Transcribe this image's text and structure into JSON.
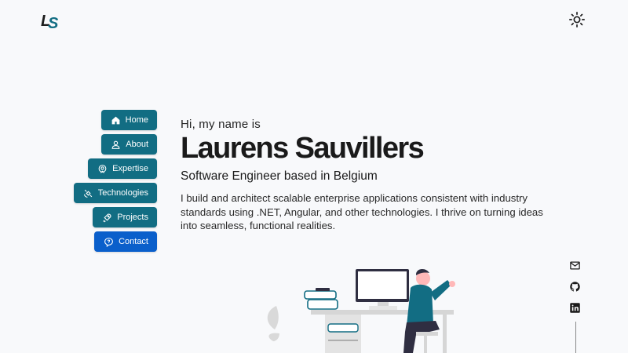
{
  "header": {
    "logo_text": "LS",
    "theme_toggle_icon": "sun-icon"
  },
  "nav": {
    "items": [
      {
        "label": "Home",
        "icon": "home-icon",
        "active": false
      },
      {
        "label": "About",
        "icon": "user-icon",
        "active": false
      },
      {
        "label": "Expertise",
        "icon": "expertise-icon",
        "active": false
      },
      {
        "label": "Technologies",
        "icon": "satellite-icon",
        "active": false
      },
      {
        "label": "Projects",
        "icon": "rocket-icon",
        "active": false
      },
      {
        "label": "Contact",
        "icon": "question-bubble-icon",
        "active": true
      }
    ]
  },
  "hero": {
    "greeting": "Hi, my name is",
    "name": "Laurens Sauvillers",
    "role": "Software Engineer based in Belgium",
    "bio": "I build and architect scalable enterprise applications consistent with industry standards using .NET, Angular, and other technologies. I thrive on turning ideas into seamless, functional realities."
  },
  "socials": [
    {
      "icon": "mail-icon"
    },
    {
      "icon": "github-icon"
    },
    {
      "icon": "linkedin-icon"
    }
  ],
  "colors": {
    "nav_bg": "#126d83",
    "nav_active_bg": "#0a5fcb",
    "logo_dark": "#1c1c1c",
    "logo_accent": "#126d83",
    "background": "#f8f9fb"
  }
}
